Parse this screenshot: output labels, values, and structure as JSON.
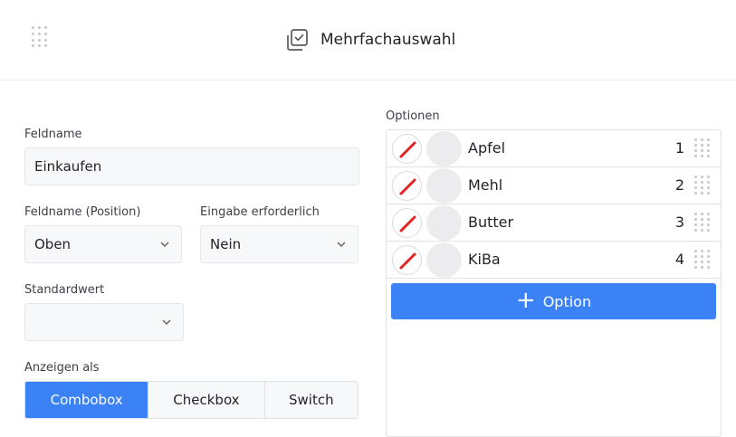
{
  "header": {
    "title": "Mehrfachauswahl",
    "icon": "multi-select-icon",
    "drag_icon": "drag-handle-icon"
  },
  "form": {
    "fieldname_label": "Feldname",
    "fieldname_value": "Einkaufen",
    "position_label": "Feldname (Position)",
    "position_value": "Oben",
    "required_label": "Eingabe erforderlich",
    "required_value": "Nein",
    "default_label": "Standardwert",
    "default_value": "",
    "display_label": "Anzeigen als",
    "display_options": [
      "Combobox",
      "Checkbox",
      "Switch"
    ],
    "display_selected": "Combobox"
  },
  "options": {
    "label": "Optionen",
    "items": [
      {
        "label": "Apfel",
        "position": "1"
      },
      {
        "label": "Mehl",
        "position": "2"
      },
      {
        "label": "Butter",
        "position": "3"
      },
      {
        "label": "KiBa",
        "position": "4"
      }
    ],
    "add_label": "Option"
  },
  "colors": {
    "accent": "#3b82f6",
    "delete_slash": "#e02424"
  }
}
